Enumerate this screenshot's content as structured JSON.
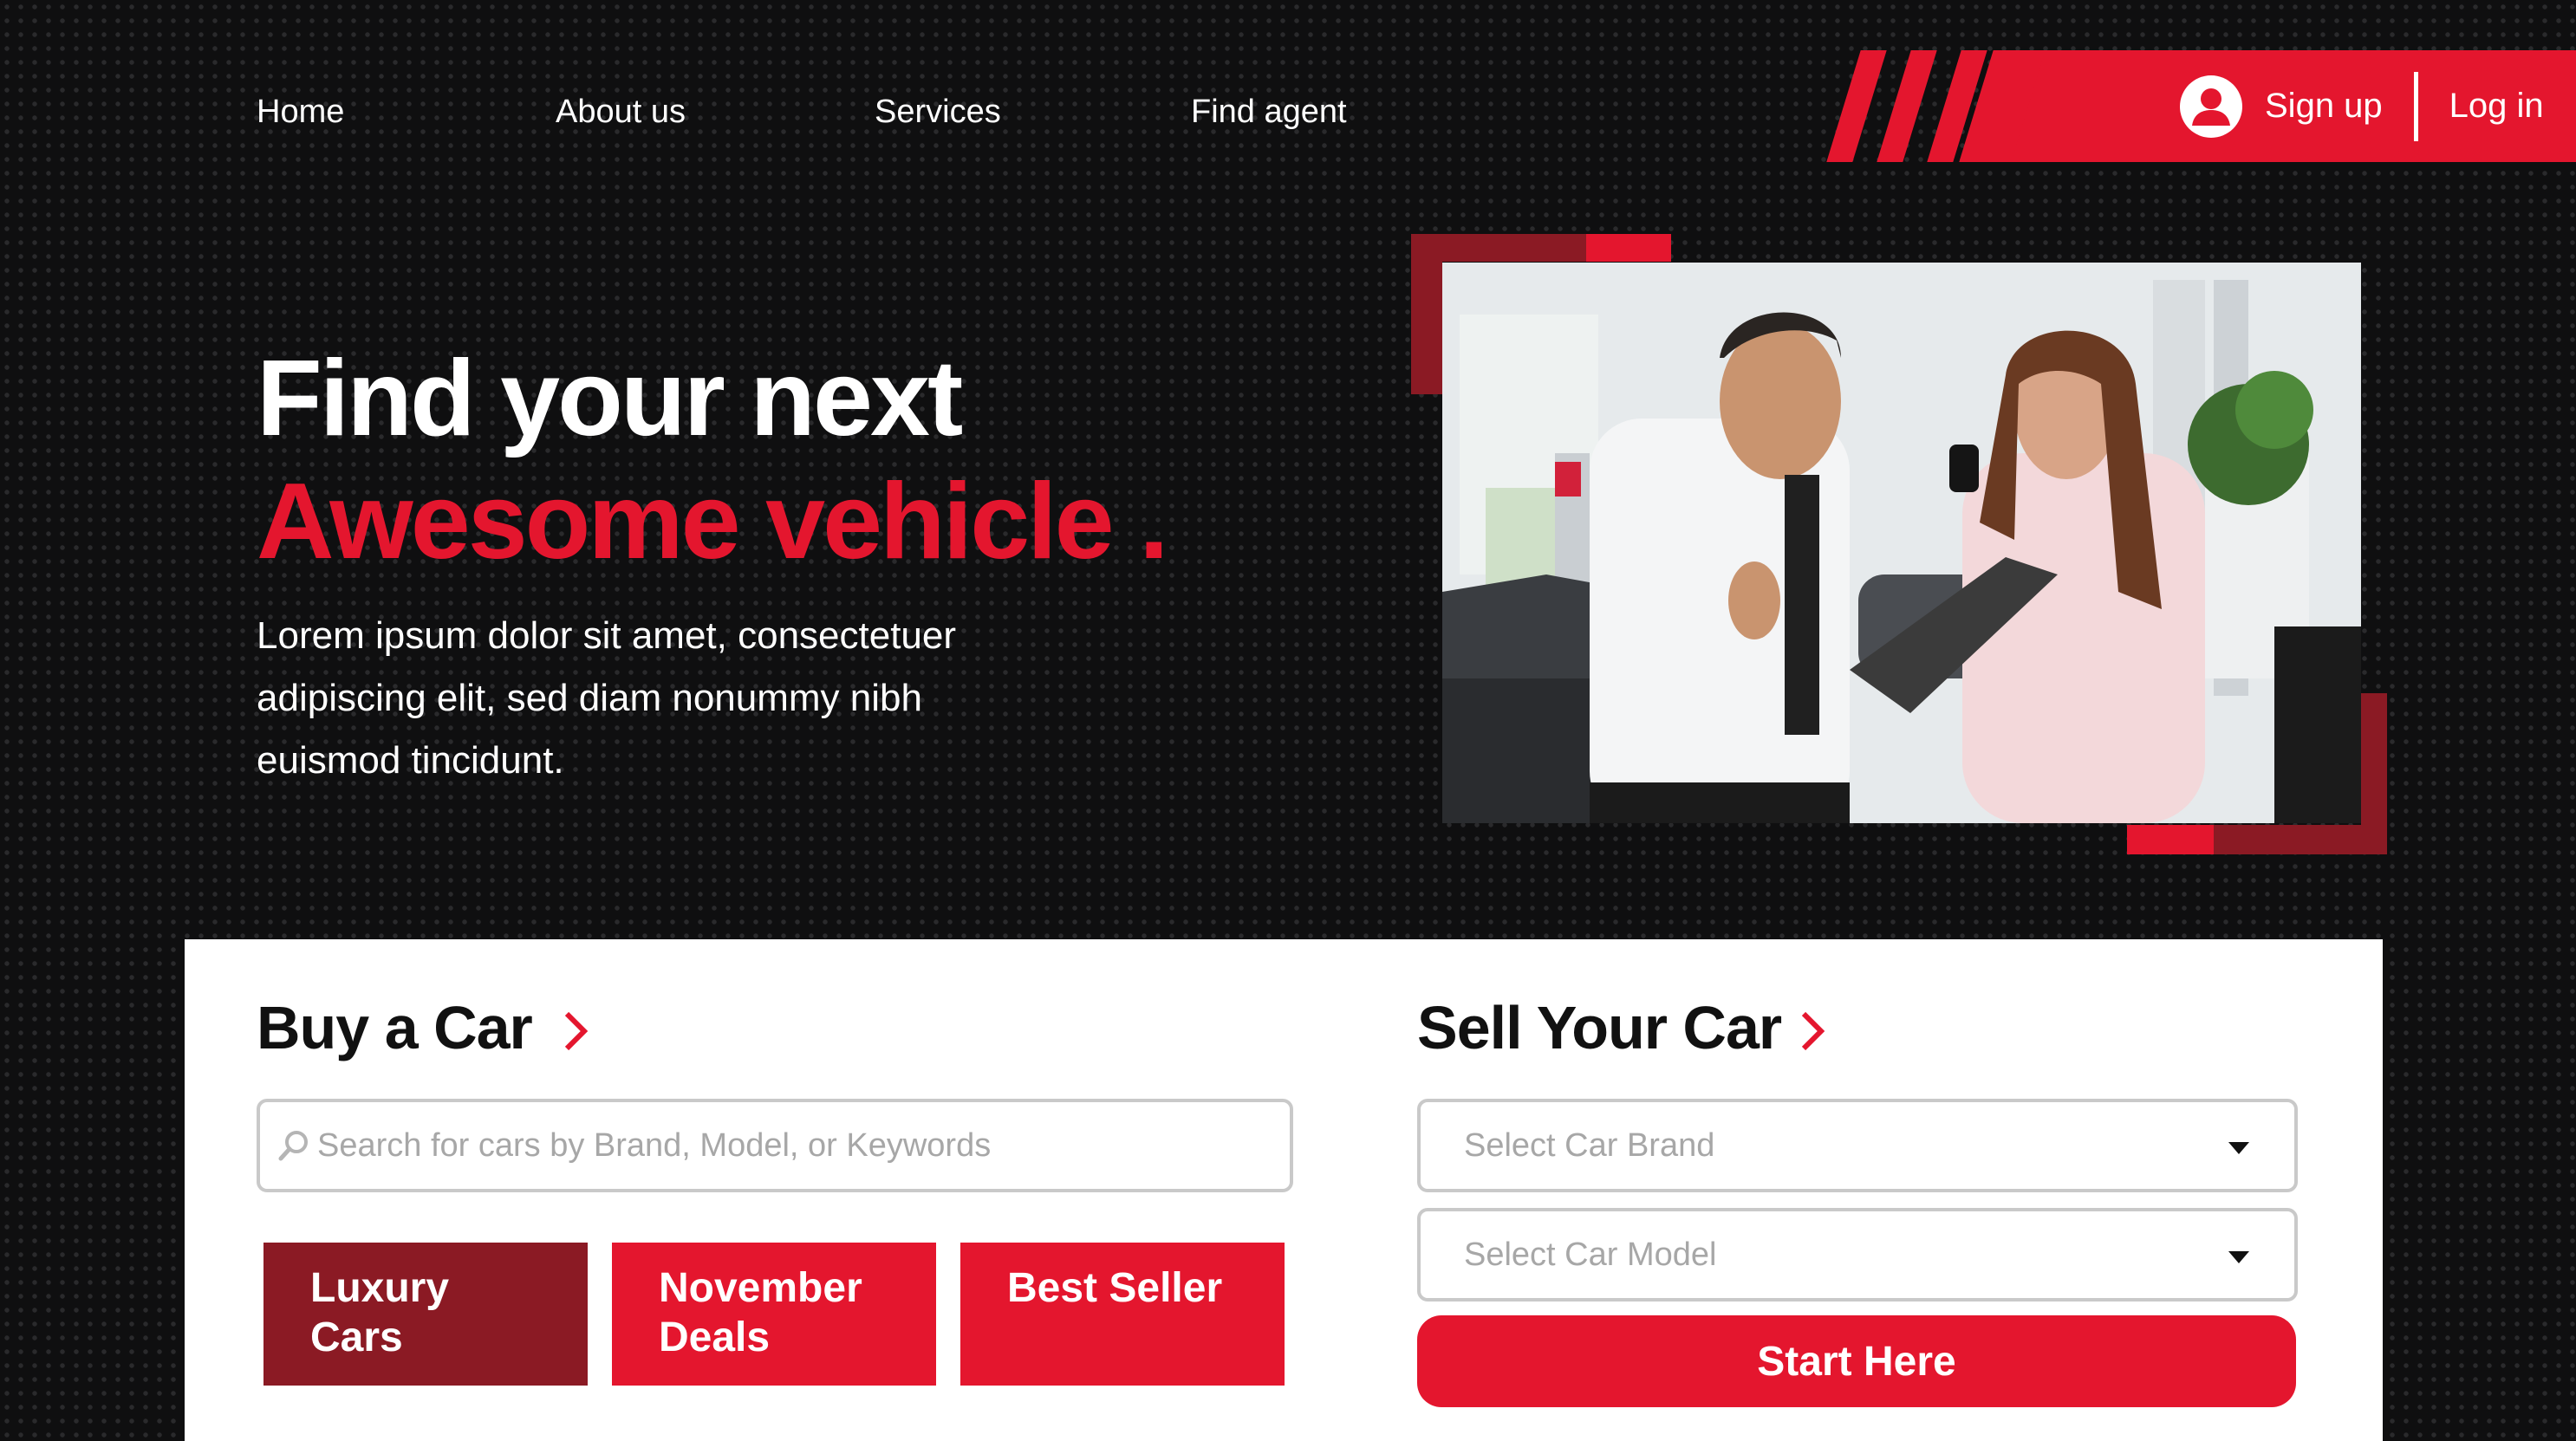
{
  "nav": {
    "items": [
      {
        "label": "Home"
      },
      {
        "label": "About us"
      },
      {
        "label": "Services"
      },
      {
        "label": "Find agent"
      }
    ]
  },
  "auth": {
    "signup_label": "Sign up",
    "login_label": "Log in",
    "icon": "user-circle-icon"
  },
  "hero": {
    "title_line1": "Find your next",
    "title_line2": "Awesome vehicle",
    "title_dot": ".",
    "description": "Lorem ipsum dolor sit amet, consectetuer adipiscing elit, sed diam nonummy nibh euismod tincidunt.",
    "image": "car-dealership-agents-photo"
  },
  "buy": {
    "title": "Buy a Car",
    "search_placeholder": "Search for cars by Brand, Model, or Keywords",
    "tiles": [
      {
        "line1": "Luxury",
        "line2": "Cars",
        "color": "#8b1a24"
      },
      {
        "line1": "November",
        "line2": "Deals",
        "color": "#e4162e"
      },
      {
        "line1": "Best Seller",
        "line2": "",
        "color": "#e4162e"
      }
    ]
  },
  "sell": {
    "title": "Sell Your Car",
    "brand_placeholder": "Select Car Brand",
    "model_placeholder": "Select Car Model",
    "start_label": "Start Here"
  },
  "colors": {
    "accent": "#e4162e",
    "accent_dark": "#8b1a24",
    "background": "#0f0f10"
  }
}
